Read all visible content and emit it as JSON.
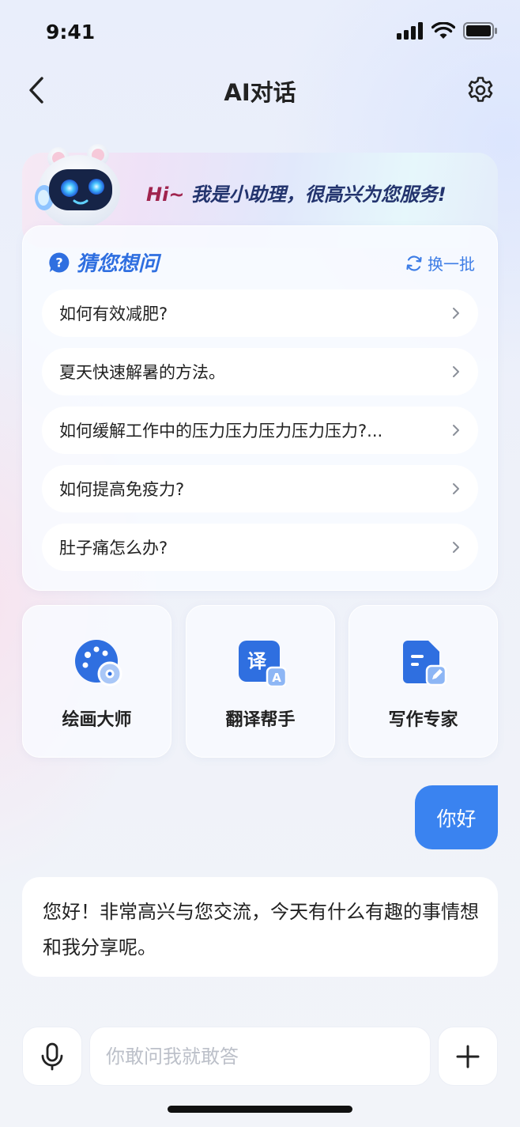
{
  "status_bar": {
    "time": "9:41"
  },
  "nav": {
    "title": "AI对话",
    "back_icon": "chevron-left-icon",
    "settings_icon": "gear-icon"
  },
  "banner": {
    "greeting_hi": "Hi~",
    "greeting_text": " 我是小助理，很高兴为您服务!"
  },
  "suggestions": {
    "title": "猜您想问",
    "refresh_label": "换一批",
    "items": [
      {
        "text": "如何有效减肥?"
      },
      {
        "text": "夏天快速解暑的方法。"
      },
      {
        "text": "如何缓解工作中的压力压力压力压力压力?..."
      },
      {
        "text": "如何提高免疫力?"
      },
      {
        "text": "肚子痛怎么办?"
      }
    ]
  },
  "tools": [
    {
      "label": "绘画大师",
      "icon": "palette-icon"
    },
    {
      "label": "翻译帮手",
      "icon": "translate-icon",
      "glyph": "译",
      "badge": "A"
    },
    {
      "label": "写作专家",
      "icon": "document-edit-icon"
    }
  ],
  "chat": {
    "user_message": "你好",
    "ai_message": "您好！非常高兴与您交流，今天有什么有趣的事情想和我分享呢。"
  },
  "input": {
    "placeholder": "你敢问我就敢答",
    "value": ""
  },
  "colors": {
    "accent": "#3a83f0",
    "title_blue": "#2f6fe0",
    "greeting_navy": "#23346e",
    "greeting_hi": "#a0244e"
  }
}
